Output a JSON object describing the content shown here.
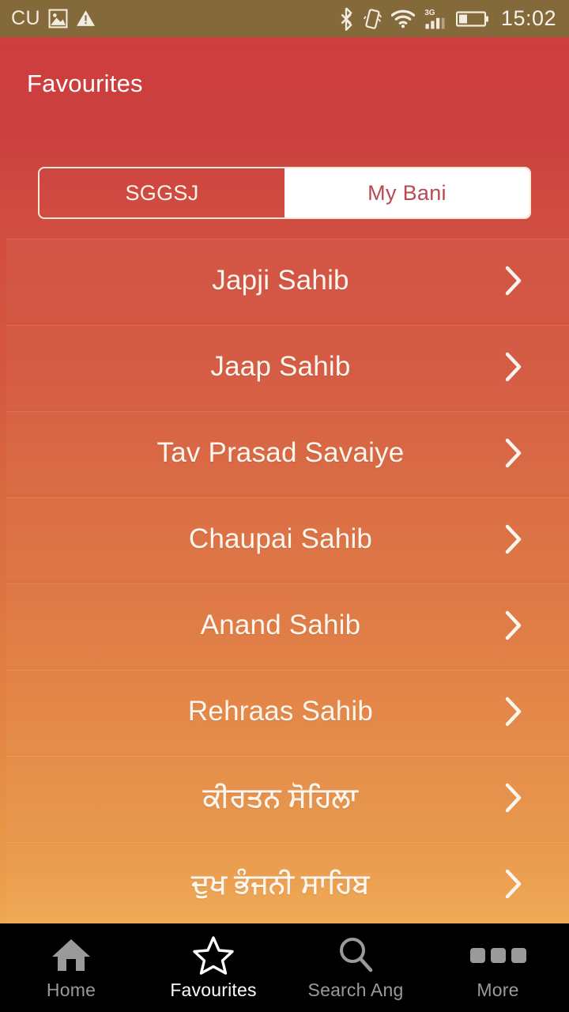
{
  "status_bar": {
    "carrier": "CU",
    "clock": "15:02",
    "left_icons": [
      {
        "name": "carrier-label",
        "label": "CU"
      },
      {
        "name": "gallery-image-icon",
        "label": "image"
      },
      {
        "name": "warning-triangle-icon",
        "label": "warning"
      }
    ],
    "right_icons": [
      {
        "name": "bluetooth-icon",
        "label": "bluetooth"
      },
      {
        "name": "vibrate-icon",
        "label": "vibrate"
      },
      {
        "name": "wifi-icon",
        "label": "wifi"
      },
      {
        "name": "cellular-signal-icon",
        "label": "3G"
      },
      {
        "name": "battery-icon",
        "label": "battery"
      }
    ],
    "network_type": "3G",
    "battery_level_percent": 38,
    "background_color": "#84693a"
  },
  "header": {
    "title": "Favourites",
    "background_color": "#cf3d3d",
    "text_color": "#ffffff"
  },
  "segmented_control": {
    "tabs": [
      {
        "label": "SGGSJ",
        "selected": false
      },
      {
        "label": "My Bani",
        "selected": true
      }
    ],
    "active_background": "#ffffff",
    "active_text_color": "#b74a52",
    "inactive_text_color": "#fdf5ec",
    "border_color": "#f4e9d9"
  },
  "list": {
    "items": [
      {
        "label": "Japji Sahib",
        "script": "latin",
        "chevron": "chevron-right-icon"
      },
      {
        "label": "Jaap Sahib",
        "script": "latin",
        "chevron": "chevron-right-icon"
      },
      {
        "label": "Tav Prasad Savaiye",
        "script": "latin",
        "chevron": "chevron-right-icon"
      },
      {
        "label": "Chaupai Sahib",
        "script": "latin",
        "chevron": "chevron-right-icon"
      },
      {
        "label": "Anand Sahib",
        "script": "latin",
        "chevron": "chevron-right-icon"
      },
      {
        "label": "Rehraas Sahib",
        "script": "latin",
        "chevron": "chevron-right-icon"
      },
      {
        "label": "ਕੀਰਤਨ ਸੋਹਿਲਾ",
        "script": "gurmukhi",
        "chevron": "chevron-right-icon"
      },
      {
        "label": "ਦੁਖ ਭੰਜਨੀ ਸਾਹਿਬ",
        "script": "gurmukhi",
        "chevron": "chevron-right-icon"
      }
    ],
    "row_text_color": "#fdf6ee",
    "gradient_top_color": "#cf3d3d",
    "gradient_bottom_color": "#efa750"
  },
  "bottom_nav": {
    "background_color": "#000000",
    "selected_color": "#ffffff",
    "unselected_color": "#9a9a9a",
    "items": [
      {
        "label": "Home",
        "icon": "home-icon",
        "selected": false
      },
      {
        "label": "Favourites",
        "icon": "star-icon",
        "selected": true
      },
      {
        "label": "Search Ang",
        "icon": "search-icon",
        "selected": false
      },
      {
        "label": "More",
        "icon": "more-dots-icon",
        "selected": false
      }
    ]
  }
}
